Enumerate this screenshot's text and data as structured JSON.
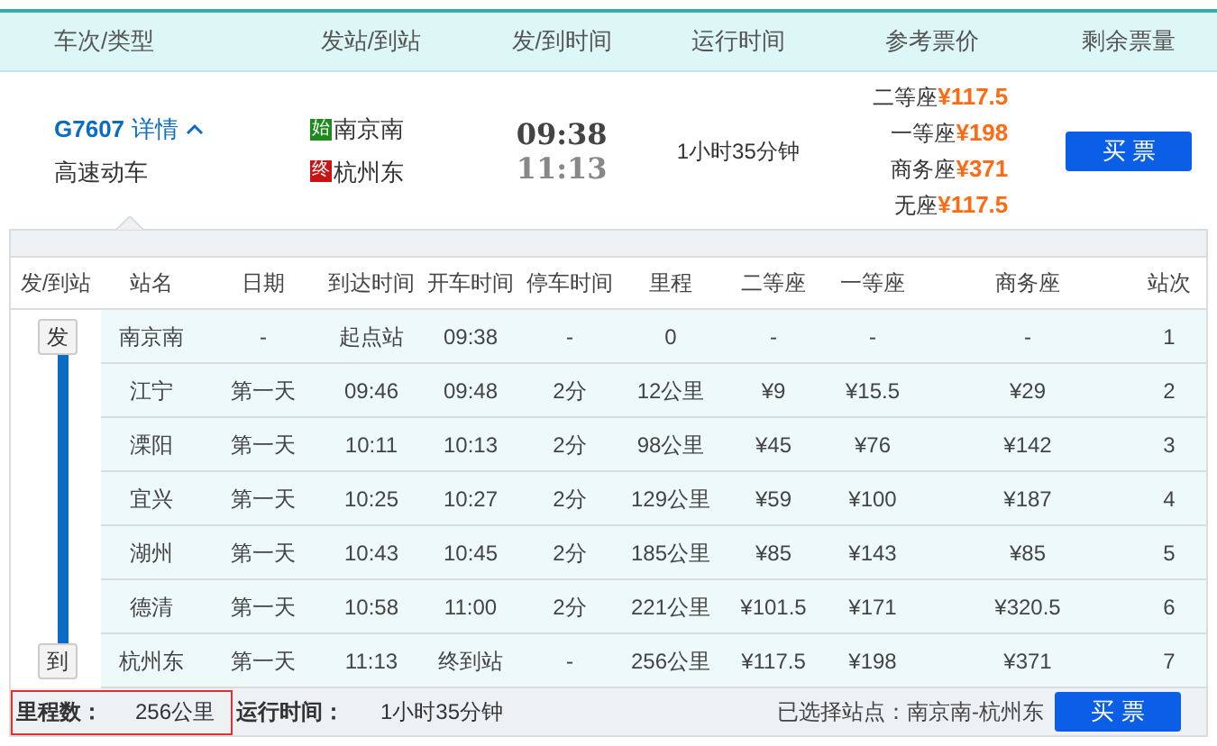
{
  "header": [
    "车次/类型",
    "发站/到站",
    "发/到时间",
    "运行时间",
    "参考票价",
    "剩余票量"
  ],
  "train": {
    "number": "G7607",
    "detail_link": "详情",
    "expanded": true,
    "type": "高速动车",
    "stations": [
      {
        "badge": "始",
        "name": "南京南",
        "color": "#1c8a1c"
      },
      {
        "badge": "终",
        "name": "杭州东",
        "color": "#c81414"
      }
    ],
    "depart_time": "09:38",
    "arrive_time": "11:13",
    "duration": "1小时35分钟",
    "prices": [
      {
        "seat": "二等座",
        "price": "¥117.5"
      },
      {
        "seat": "一等座",
        "price": "¥198"
      },
      {
        "seat": "商务座",
        "price": "¥371"
      },
      {
        "seat": "无座",
        "price": "¥117.5"
      }
    ],
    "buy": "买 票"
  },
  "stops": {
    "columns": [
      "发/到站",
      "站名",
      "日期",
      "到达时间",
      "开车时间",
      "停车时间",
      "里程",
      "二等座",
      "一等座",
      "商务座",
      "站次"
    ],
    "rows": [
      {
        "cells": [
          "发",
          "南京南",
          "-",
          "起点站",
          "09:38",
          "-",
          "0",
          "-",
          "-",
          "-",
          "1"
        ]
      },
      {
        "cells": [
          "",
          "江宁",
          "第一天",
          "09:46",
          "09:48",
          "2分",
          "12公里",
          "¥9",
          "¥15.5",
          "¥29",
          "2"
        ]
      },
      {
        "cells": [
          "",
          "溧阳",
          "第一天",
          "10:11",
          "10:13",
          "2分",
          "98公里",
          "¥45",
          "¥76",
          "¥142",
          "3"
        ]
      },
      {
        "cells": [
          "",
          "宜兴",
          "第一天",
          "10:25",
          "10:27",
          "2分",
          "129公里",
          "¥59",
          "¥100",
          "¥187",
          "4"
        ]
      },
      {
        "cells": [
          "",
          "湖州",
          "第一天",
          "10:43",
          "10:45",
          "2分",
          "185公里",
          "¥85",
          "¥143",
          "¥85",
          "5"
        ]
      },
      {
        "cells": [
          "",
          "德清",
          "第一天",
          "10:58",
          "11:00",
          "2分",
          "221公里",
          "¥101.5",
          "¥171",
          "¥320.5",
          "6"
        ]
      },
      {
        "cells": [
          "到",
          "杭州东",
          "第一天",
          "11:13",
          "终到站",
          "-",
          "256公里",
          "¥117.5",
          "¥198",
          "¥371",
          "7"
        ]
      }
    ]
  },
  "footer": {
    "distance_label": "里程数：",
    "distance": "256公里",
    "distance_highlighted": true,
    "duration_label": "运行时间：",
    "duration": "1小时35分钟",
    "selected_label": "已选择站点：南京南-杭州东",
    "buy": "买 票"
  }
}
